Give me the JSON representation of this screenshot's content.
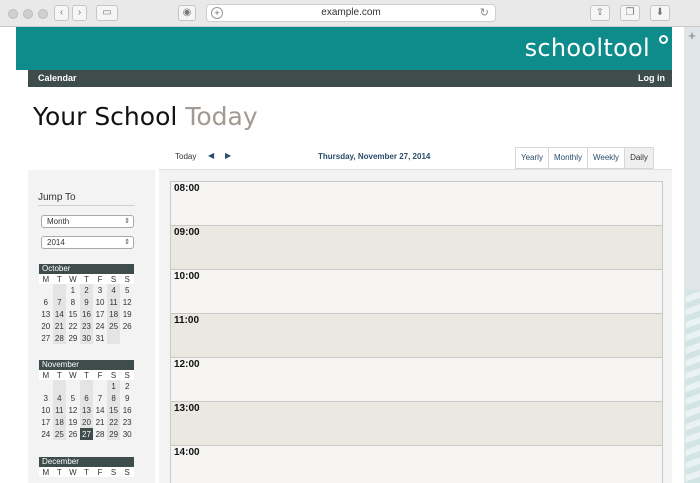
{
  "browser": {
    "url": "example.com",
    "back_icon": "chevron-left",
    "forward_icon": "chevron-right"
  },
  "header": {
    "logo": "schooltool",
    "nav_left": "Calendar",
    "nav_right": "Log in"
  },
  "page": {
    "title": "Your School",
    "subtitle": "Today"
  },
  "sidebar": {
    "jump_to": "Jump To",
    "select_view": "Month",
    "select_year": "2014",
    "calendars": [
      {
        "month": "October",
        "dow": [
          "M",
          "T",
          "W",
          "T",
          "F",
          "S",
          "S"
        ],
        "rows": [
          [
            "",
            "",
            "1",
            "2",
            "3",
            "4",
            "5"
          ],
          [
            "6",
            "7",
            "8",
            "9",
            "10",
            "11",
            "12"
          ],
          [
            "13",
            "14",
            "15",
            "16",
            "17",
            "18",
            "19"
          ],
          [
            "20",
            "21",
            "22",
            "23",
            "24",
            "25",
            "26"
          ],
          [
            "27",
            "28",
            "29",
            "30",
            "31",
            "",
            ""
          ]
        ]
      },
      {
        "month": "November",
        "dow": [
          "M",
          "T",
          "W",
          "T",
          "F",
          "S",
          "S"
        ],
        "rows": [
          [
            "",
            "",
            "",
            "",
            "",
            "1",
            "2"
          ],
          [
            "3",
            "4",
            "5",
            "6",
            "7",
            "8",
            "9"
          ],
          [
            "10",
            "11",
            "12",
            "13",
            "14",
            "15",
            "16"
          ],
          [
            "17",
            "18",
            "19",
            "20",
            "21",
            "22",
            "23"
          ],
          [
            "24",
            "25",
            "26",
            "27",
            "28",
            "29",
            "30"
          ]
        ],
        "today": "27"
      },
      {
        "month": "December",
        "dow": [
          "M",
          "T",
          "W",
          "T",
          "F",
          "S",
          "S"
        ],
        "rows": []
      }
    ]
  },
  "calendar": {
    "today_label": "Today",
    "prev_icon": "◀",
    "next_icon": "▶",
    "current_date": "Thursday, November 27, 2014",
    "tabs": [
      "Yearly",
      "Monthly",
      "Weekly",
      "Daily"
    ],
    "active_tab": "Daily",
    "hours": [
      "08:00",
      "09:00",
      "10:00",
      "11:00",
      "12:00",
      "13:00",
      "14:00"
    ]
  }
}
